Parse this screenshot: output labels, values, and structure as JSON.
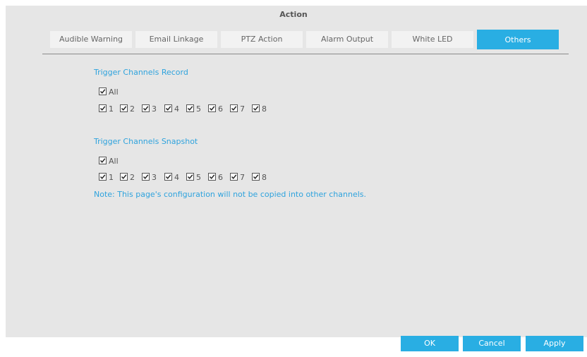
{
  "header": {
    "title": "Action"
  },
  "tabs": [
    {
      "label": "Audible Warning"
    },
    {
      "label": "Email Linkage"
    },
    {
      "label": "PTZ Action"
    },
    {
      "label": "Alarm Output"
    },
    {
      "label": "White LED"
    },
    {
      "label": "Others",
      "active": true
    }
  ],
  "record": {
    "title": "Trigger Channels Record",
    "all": {
      "label": "All",
      "checked": true
    },
    "channels": [
      {
        "label": "1",
        "checked": true
      },
      {
        "label": "2",
        "checked": true
      },
      {
        "label": "3",
        "checked": true
      },
      {
        "label": "4",
        "checked": true
      },
      {
        "label": "5",
        "checked": true
      },
      {
        "label": "6",
        "checked": true
      },
      {
        "label": "7",
        "checked": true
      },
      {
        "label": "8",
        "checked": true
      }
    ]
  },
  "snapshot": {
    "title": "Trigger Channels Snapshot",
    "all": {
      "label": "All",
      "checked": true
    },
    "channels": [
      {
        "label": "1",
        "checked": true
      },
      {
        "label": "2",
        "checked": true
      },
      {
        "label": "3",
        "checked": true
      },
      {
        "label": "4",
        "checked": true
      },
      {
        "label": "5",
        "checked": true
      },
      {
        "label": "6",
        "checked": true
      },
      {
        "label": "7",
        "checked": true
      },
      {
        "label": "8",
        "checked": true
      }
    ]
  },
  "note": "Note: This page's configuration will not be copied into other channels.",
  "buttons": {
    "ok": "OK",
    "cancel": "Cancel",
    "apply": "Apply"
  },
  "colors": {
    "accent": "#29aee3",
    "section_text": "#2fa3dd",
    "panel": "#e6e6e6"
  }
}
